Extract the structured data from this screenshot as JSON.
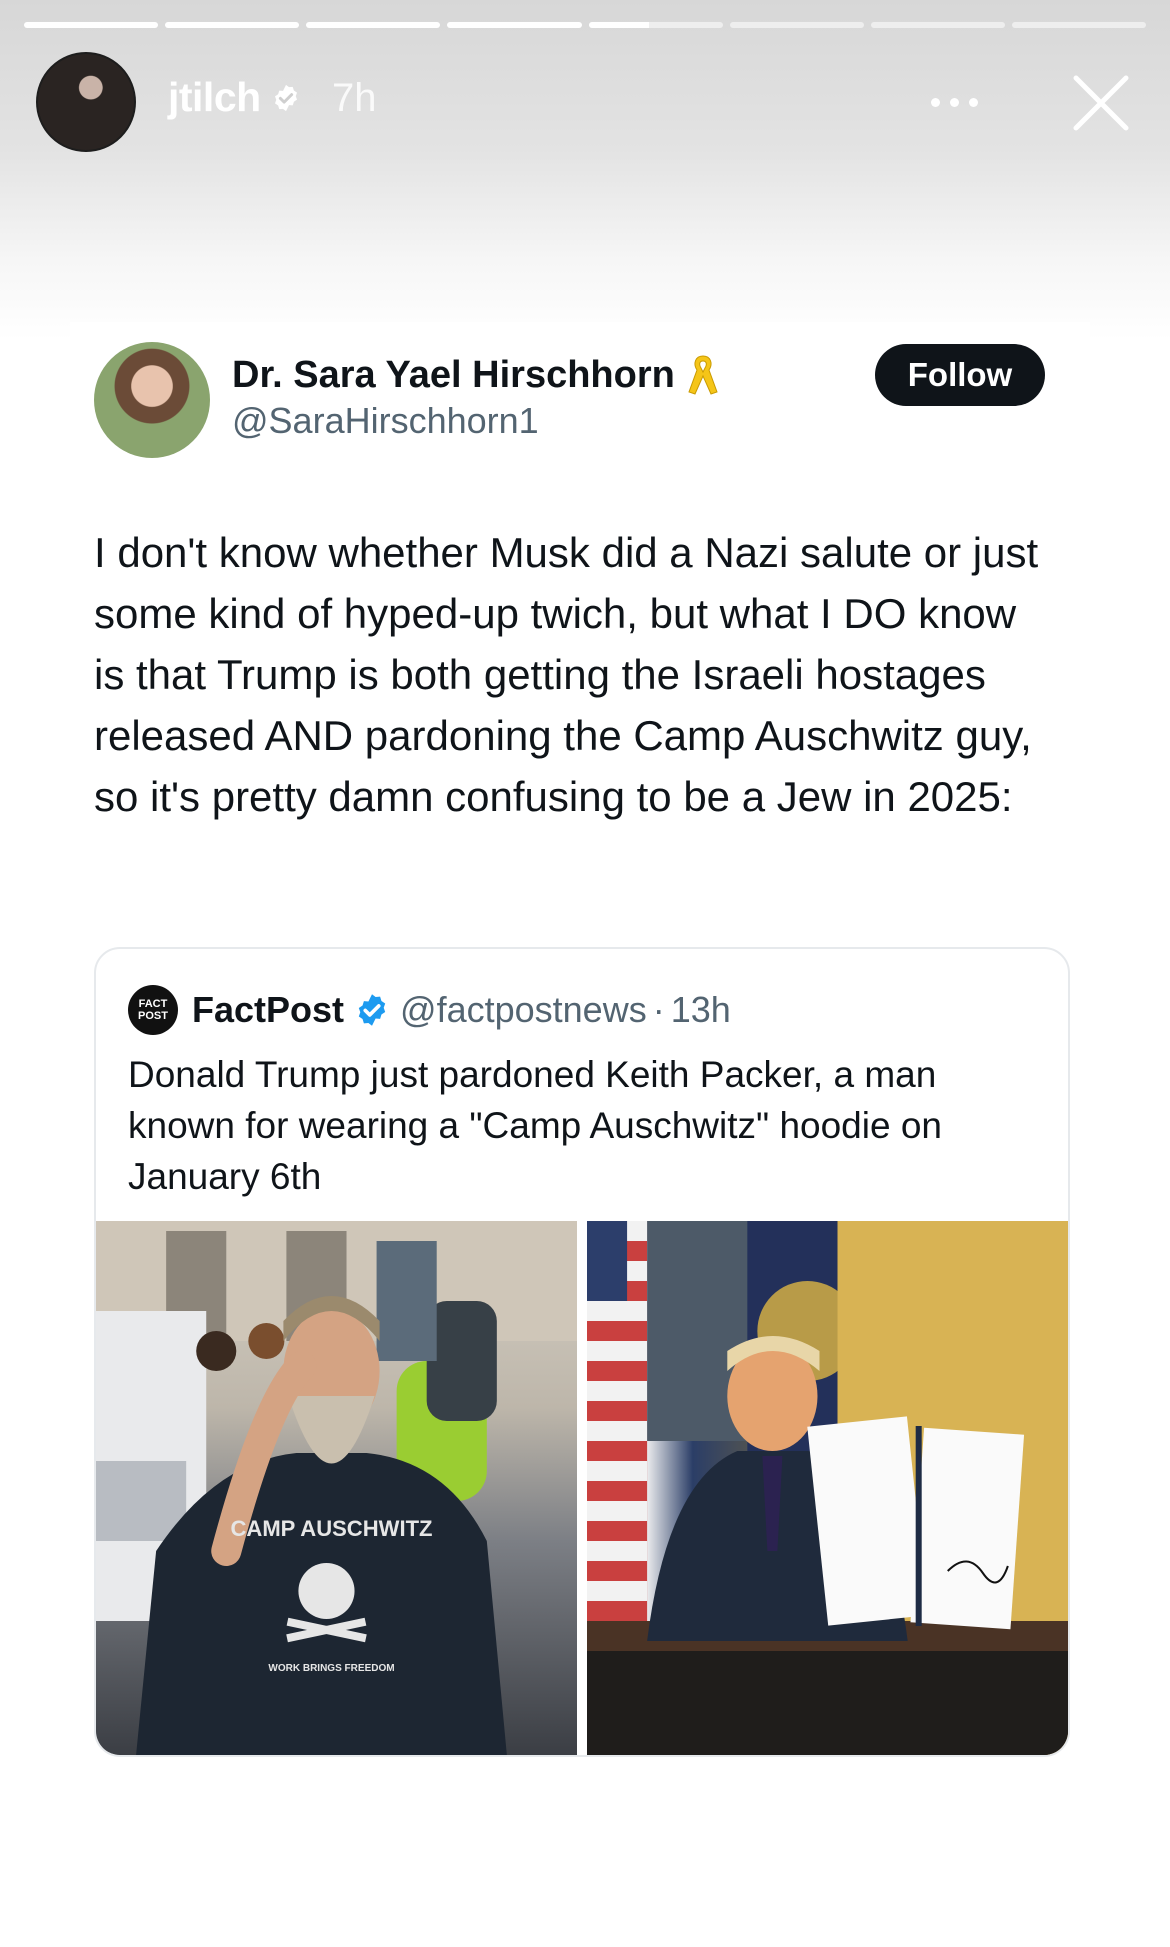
{
  "story": {
    "progress_segments": 8,
    "active_segment": 5,
    "active_progress": 0.45,
    "username": "jtilch",
    "time": "7h"
  },
  "tweet": {
    "display_name": "Dr. Sara Yael Hirschhorn",
    "handle": "@SaraHirschhorn1",
    "follow_label": "Follow",
    "text": "I don't know whether Musk did a Nazi salute or just some kind of hyped-up twich, but what I DO know is that Trump is both getting the Israeli hostages released AND pardoning the Camp Auschwitz guy, so it's pretty damn confusing to be a Jew in 2025:"
  },
  "quote": {
    "logo_text": [
      "FACT",
      "POST"
    ],
    "name": "FactPost",
    "handle": "@factpostnews",
    "separator": "·",
    "time": "13h",
    "text": "Donald Trump just pardoned Keith Packer, a man known for wearing a \"Camp Auschwitz\" hoodie on January 6th",
    "hoodie_text": "CAMP AUSCHWITZ",
    "hoodie_subtext": "WORK BRINGS FREEDOM"
  },
  "colors": {
    "verified_blue": "#1d9bf0",
    "ribbon_yellow": "#f5c518",
    "follow_bg": "#0f1419"
  }
}
